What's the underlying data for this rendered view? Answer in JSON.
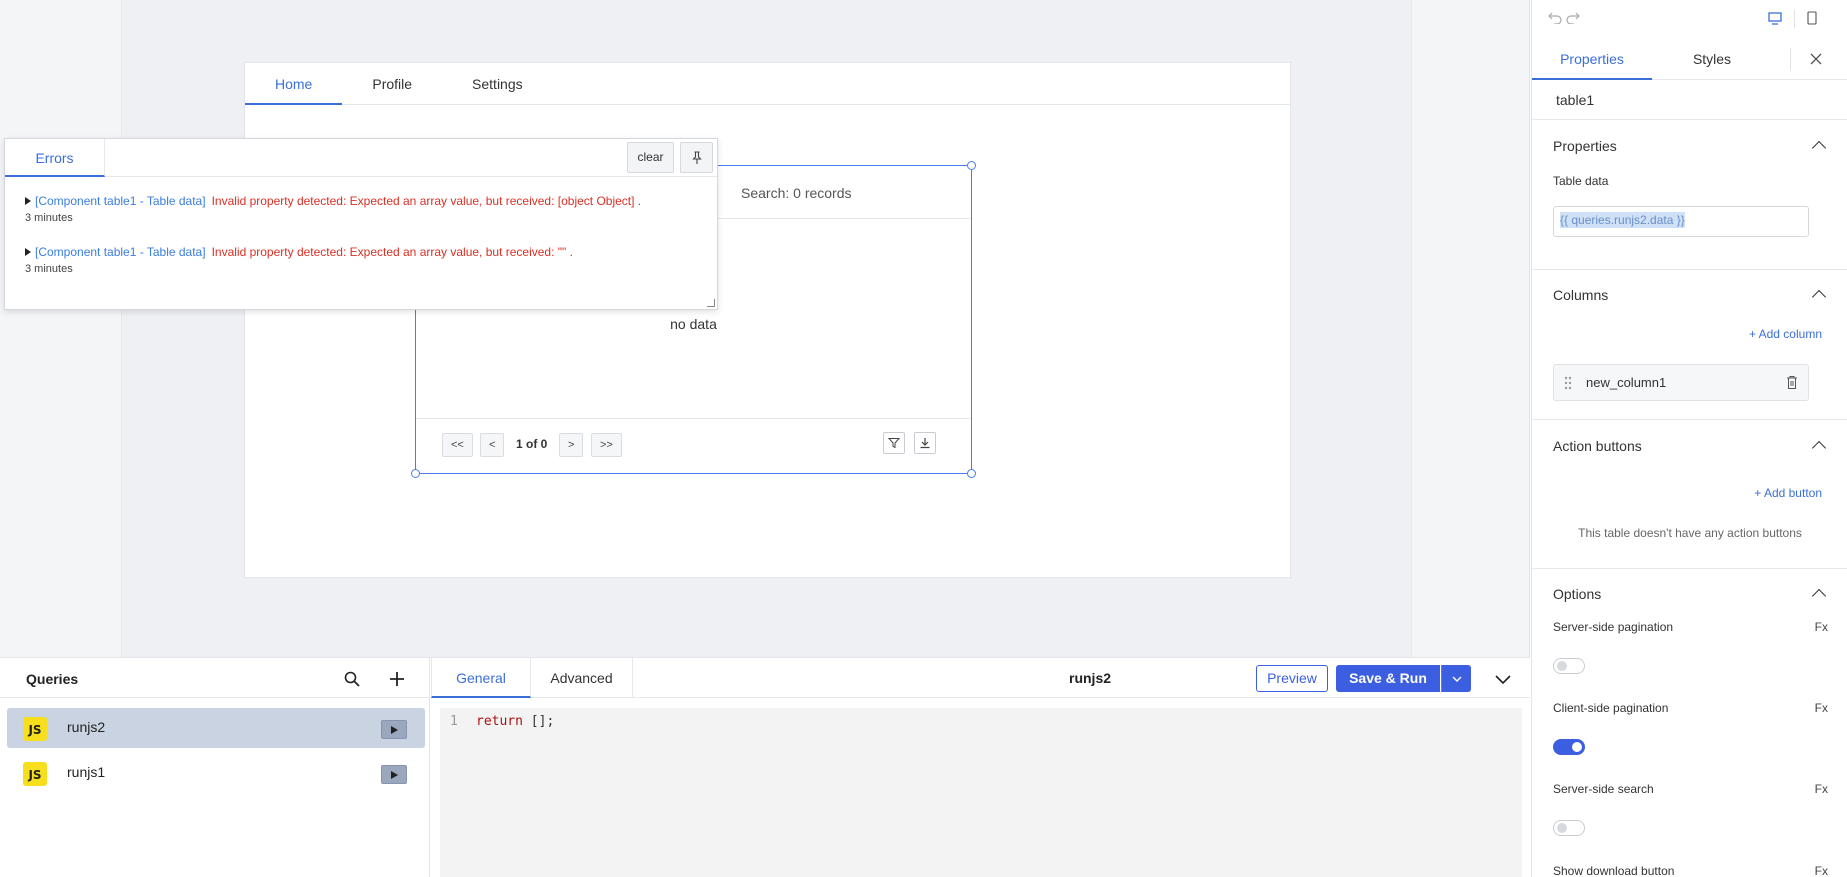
{
  "app": {
    "tabs": [
      "Home",
      "Profile",
      "Settings"
    ],
    "active_tab": "Home"
  },
  "table_widget": {
    "search_label": "Search:",
    "records": "0 records",
    "empty_text": "no data",
    "pagination": {
      "first": "<<",
      "prev": "<",
      "page_info": "1 of 0",
      "next": ">",
      "last": ">>"
    }
  },
  "errors_panel": {
    "tab_label": "Errors",
    "clear_label": "clear",
    "errors": [
      {
        "source": "[Component table1 - Table data]",
        "message": "Invalid property detected: Expected an array value, but received: [object Object] .",
        "time": "3 minutes"
      },
      {
        "source": "[Component table1 - Table data]",
        "message": "Invalid property detected: Expected an array value, but received: \"\" .",
        "time": "3 minutes"
      }
    ]
  },
  "inspector": {
    "tabs": [
      "Properties",
      "Styles"
    ],
    "active_tab": "Properties",
    "component_name": "table1",
    "properties_section": {
      "title": "Properties",
      "table_data_label": "Table data",
      "table_data_value": "{{ queries.runjs2.data }}"
    },
    "columns_section": {
      "title": "Columns",
      "add_label": "+ Add column",
      "columns": [
        "new_column1"
      ]
    },
    "action_buttons_section": {
      "title": "Action buttons",
      "add_label": "+ Add button",
      "empty_text": "This table doesn't have any action buttons"
    },
    "options_section": {
      "title": "Options",
      "fx_label": "Fx",
      "options": [
        {
          "label": "Server-side pagination",
          "enabled": false
        },
        {
          "label": "Client-side pagination",
          "enabled": true
        },
        {
          "label": "Server-side search",
          "enabled": false
        },
        {
          "label": "Show download button",
          "enabled": null
        }
      ]
    }
  },
  "queries": {
    "title": "Queries",
    "items": [
      {
        "name": "runjs2",
        "badge": "JS",
        "selected": true
      },
      {
        "name": "runjs1",
        "badge": "JS",
        "selected": false
      }
    ]
  },
  "query_editor": {
    "tabs": [
      "General",
      "Advanced"
    ],
    "active_tab": "General",
    "query_name": "runjs2",
    "preview_label": "Preview",
    "save_run_label": "Save & Run",
    "code": {
      "line_number": "1",
      "keyword": "return",
      "rest": " [];"
    }
  },
  "colors": {
    "accent": "#3b6fd8",
    "primary_button": "#3b5fe0",
    "error_text": "#d93025",
    "error_source": "#3b7ddd",
    "js_badge": "#f7df1e"
  }
}
